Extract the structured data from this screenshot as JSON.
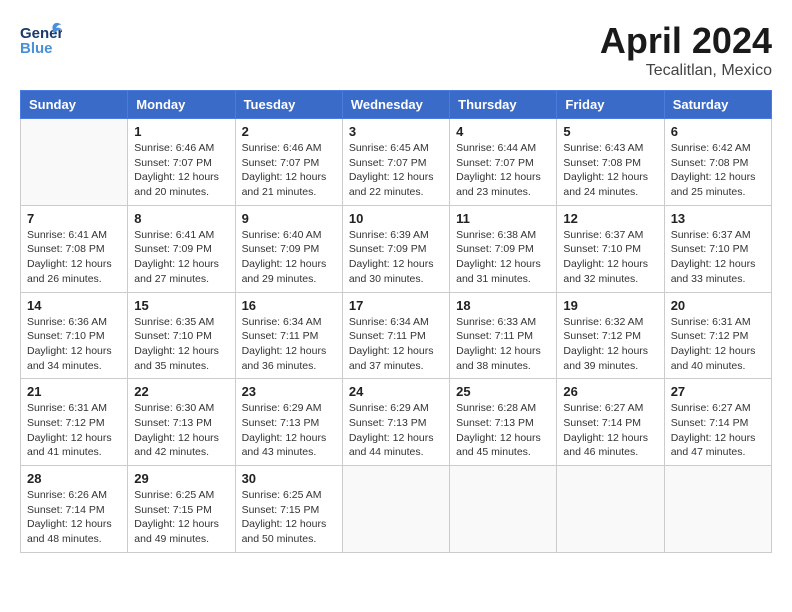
{
  "header": {
    "logo_general": "General",
    "logo_blue": "Blue",
    "month": "April 2024",
    "location": "Tecalitlan, Mexico"
  },
  "weekdays": [
    "Sunday",
    "Monday",
    "Tuesday",
    "Wednesday",
    "Thursday",
    "Friday",
    "Saturday"
  ],
  "weeks": [
    [
      {
        "day": "",
        "info": ""
      },
      {
        "day": "1",
        "info": "Sunrise: 6:46 AM\nSunset: 7:07 PM\nDaylight: 12 hours\nand 20 minutes."
      },
      {
        "day": "2",
        "info": "Sunrise: 6:46 AM\nSunset: 7:07 PM\nDaylight: 12 hours\nand 21 minutes."
      },
      {
        "day": "3",
        "info": "Sunrise: 6:45 AM\nSunset: 7:07 PM\nDaylight: 12 hours\nand 22 minutes."
      },
      {
        "day": "4",
        "info": "Sunrise: 6:44 AM\nSunset: 7:07 PM\nDaylight: 12 hours\nand 23 minutes."
      },
      {
        "day": "5",
        "info": "Sunrise: 6:43 AM\nSunset: 7:08 PM\nDaylight: 12 hours\nand 24 minutes."
      },
      {
        "day": "6",
        "info": "Sunrise: 6:42 AM\nSunset: 7:08 PM\nDaylight: 12 hours\nand 25 minutes."
      }
    ],
    [
      {
        "day": "7",
        "info": "Sunrise: 6:41 AM\nSunset: 7:08 PM\nDaylight: 12 hours\nand 26 minutes."
      },
      {
        "day": "8",
        "info": "Sunrise: 6:41 AM\nSunset: 7:09 PM\nDaylight: 12 hours\nand 27 minutes."
      },
      {
        "day": "9",
        "info": "Sunrise: 6:40 AM\nSunset: 7:09 PM\nDaylight: 12 hours\nand 29 minutes."
      },
      {
        "day": "10",
        "info": "Sunrise: 6:39 AM\nSunset: 7:09 PM\nDaylight: 12 hours\nand 30 minutes."
      },
      {
        "day": "11",
        "info": "Sunrise: 6:38 AM\nSunset: 7:09 PM\nDaylight: 12 hours\nand 31 minutes."
      },
      {
        "day": "12",
        "info": "Sunrise: 6:37 AM\nSunset: 7:10 PM\nDaylight: 12 hours\nand 32 minutes."
      },
      {
        "day": "13",
        "info": "Sunrise: 6:37 AM\nSunset: 7:10 PM\nDaylight: 12 hours\nand 33 minutes."
      }
    ],
    [
      {
        "day": "14",
        "info": "Sunrise: 6:36 AM\nSunset: 7:10 PM\nDaylight: 12 hours\nand 34 minutes."
      },
      {
        "day": "15",
        "info": "Sunrise: 6:35 AM\nSunset: 7:10 PM\nDaylight: 12 hours\nand 35 minutes."
      },
      {
        "day": "16",
        "info": "Sunrise: 6:34 AM\nSunset: 7:11 PM\nDaylight: 12 hours\nand 36 minutes."
      },
      {
        "day": "17",
        "info": "Sunrise: 6:34 AM\nSunset: 7:11 PM\nDaylight: 12 hours\nand 37 minutes."
      },
      {
        "day": "18",
        "info": "Sunrise: 6:33 AM\nSunset: 7:11 PM\nDaylight: 12 hours\nand 38 minutes."
      },
      {
        "day": "19",
        "info": "Sunrise: 6:32 AM\nSunset: 7:12 PM\nDaylight: 12 hours\nand 39 minutes."
      },
      {
        "day": "20",
        "info": "Sunrise: 6:31 AM\nSunset: 7:12 PM\nDaylight: 12 hours\nand 40 minutes."
      }
    ],
    [
      {
        "day": "21",
        "info": "Sunrise: 6:31 AM\nSunset: 7:12 PM\nDaylight: 12 hours\nand 41 minutes."
      },
      {
        "day": "22",
        "info": "Sunrise: 6:30 AM\nSunset: 7:13 PM\nDaylight: 12 hours\nand 42 minutes."
      },
      {
        "day": "23",
        "info": "Sunrise: 6:29 AM\nSunset: 7:13 PM\nDaylight: 12 hours\nand 43 minutes."
      },
      {
        "day": "24",
        "info": "Sunrise: 6:29 AM\nSunset: 7:13 PM\nDaylight: 12 hours\nand 44 minutes."
      },
      {
        "day": "25",
        "info": "Sunrise: 6:28 AM\nSunset: 7:13 PM\nDaylight: 12 hours\nand 45 minutes."
      },
      {
        "day": "26",
        "info": "Sunrise: 6:27 AM\nSunset: 7:14 PM\nDaylight: 12 hours\nand 46 minutes."
      },
      {
        "day": "27",
        "info": "Sunrise: 6:27 AM\nSunset: 7:14 PM\nDaylight: 12 hours\nand 47 minutes."
      }
    ],
    [
      {
        "day": "28",
        "info": "Sunrise: 6:26 AM\nSunset: 7:14 PM\nDaylight: 12 hours\nand 48 minutes."
      },
      {
        "day": "29",
        "info": "Sunrise: 6:25 AM\nSunset: 7:15 PM\nDaylight: 12 hours\nand 49 minutes."
      },
      {
        "day": "30",
        "info": "Sunrise: 6:25 AM\nSunset: 7:15 PM\nDaylight: 12 hours\nand 50 minutes."
      },
      {
        "day": "",
        "info": ""
      },
      {
        "day": "",
        "info": ""
      },
      {
        "day": "",
        "info": ""
      },
      {
        "day": "",
        "info": ""
      }
    ]
  ]
}
